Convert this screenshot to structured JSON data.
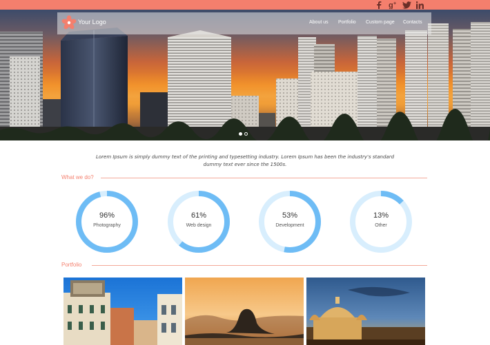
{
  "brand": {
    "logo_text": "Your Logo",
    "accent_color": "#f47f6d"
  },
  "social": [
    {
      "name": "facebook-icon",
      "label": "f"
    },
    {
      "name": "google-plus-icon",
      "label": "g+"
    },
    {
      "name": "twitter-icon",
      "label": "twitter"
    },
    {
      "name": "linkedin-icon",
      "label": "in"
    }
  ],
  "nav": {
    "items": [
      "About us",
      "Portfolio",
      "Custom page",
      "Contacts"
    ]
  },
  "slider": {
    "slides_count": 2,
    "active_slide": 1
  },
  "intro_text": "Lorem Ipsum is simply dummy text of the printing and typesetting industry. Lorem Ipsum has been the industry's standard dummy text ever since the 1500s.",
  "what_we_do": {
    "title": "What we do?",
    "stats": [
      {
        "percent": 96,
        "percent_label": "96%",
        "label": "Photography"
      },
      {
        "percent": 61,
        "percent_label": "61%",
        "label": "Web design"
      },
      {
        "percent": 53,
        "percent_label": "53%",
        "label": "Development"
      },
      {
        "percent": 13,
        "percent_label": "13%",
        "label": "Other"
      }
    ],
    "ring_color": "#6ebcf5",
    "track_color": "#d8eefd"
  },
  "portfolio": {
    "title": "Portfolio",
    "items": [
      "venice-image",
      "rio-image",
      "church-image"
    ]
  }
}
